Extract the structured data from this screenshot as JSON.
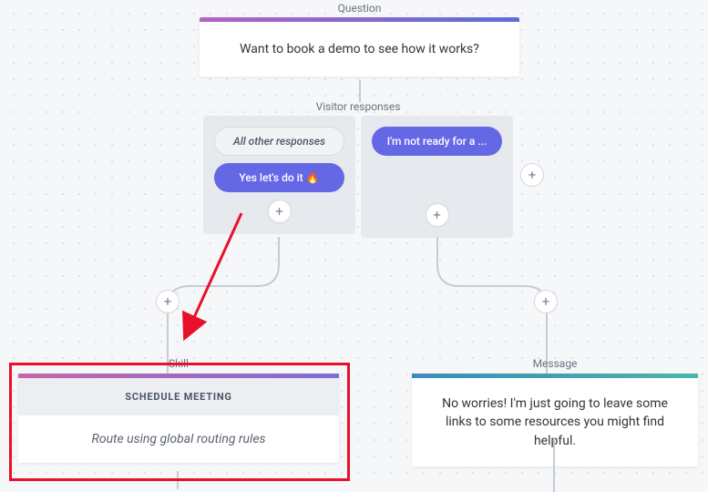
{
  "labels": {
    "question": "Question",
    "visitor_responses": "Visitor responses",
    "skill": "Skill",
    "message": "Message"
  },
  "question": {
    "text": "Want to book a demo to see how it works?"
  },
  "responses": {
    "left": {
      "pill_other": "All other responses",
      "pill_yes": "Yes let's do it 🔥"
    },
    "right": {
      "pill_notready": "I'm not ready for a ..."
    }
  },
  "skill": {
    "header": "SCHEDULE MEETING",
    "body": "Route using global routing rules"
  },
  "message": {
    "text": "No worries! I'm just going to leave some links to some resources you might find helpful."
  },
  "icons": {
    "plus": "+"
  }
}
